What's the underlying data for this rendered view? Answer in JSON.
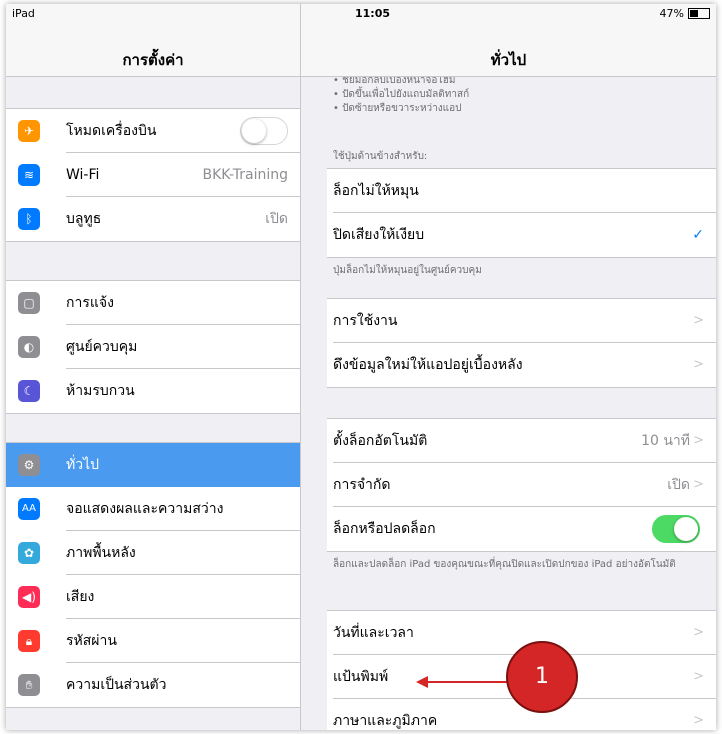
{
  "status": {
    "device": "iPad",
    "time": "11:05",
    "battery": "47%",
    "battery_fraction": 0.47
  },
  "left": {
    "title": "การตั้งค่า",
    "group1": [
      {
        "label": "โหมดเครื่องบิน",
        "icon": "airplane-icon",
        "color": "#ff9500",
        "toggle": false
      },
      {
        "label": "Wi-Fi",
        "value": "BKK-Training",
        "icon": "wifi-icon",
        "color": "#007aff"
      },
      {
        "label": "บลูทูธ",
        "value": "เปิด",
        "icon": "bluetooth-icon",
        "color": "#007aff"
      }
    ],
    "group2": [
      {
        "label": "การแจ้ง",
        "icon": "notifications-icon",
        "color": "#8e8e93"
      },
      {
        "label": "ศูนย์ควบคุม",
        "icon": "control-center-icon",
        "color": "#8e8e93"
      },
      {
        "label": "ห้ามรบกวน",
        "icon": "moon-icon",
        "color": "#5856d6"
      }
    ],
    "group3": [
      {
        "label": "ทั่วไป",
        "icon": "gear-icon",
        "color": "#8e8e93",
        "selected": true
      },
      {
        "label": "จอแสดงผลและความสว่าง",
        "icon": "display-icon",
        "color": "#007aff"
      },
      {
        "label": "ภาพพื้นหลัง",
        "icon": "wallpaper-icon",
        "color": "#34aadc"
      },
      {
        "label": "เสียง",
        "icon": "sound-icon",
        "color": "#ff2d55"
      },
      {
        "label": "รหัสผ่าน",
        "icon": "lock-icon",
        "color": "#ff3b30"
      },
      {
        "label": "ความเป็นส่วนตัว",
        "icon": "hand-icon",
        "color": "#8e8e93"
      }
    ]
  },
  "right": {
    "title": "ทั่วไป",
    "top_notes": [
      "• ชัยมือกลับเบื้องหน้าจอโฮม",
      "• ปัดขึ้นเพื่อไปยังแถบมัลติทาสก์",
      "• ปัดซ้ายหรือขวาระหว่างแอป"
    ],
    "side_switch_header": "ใช้ปุ่มด้านข้างสำหรับ:",
    "side_switch": [
      {
        "label": "ล็อกไม่ให้หมุน"
      },
      {
        "label": "ปิดเสียงให้เงียบ",
        "checked": true
      }
    ],
    "side_switch_footer": "ปุ่มล็อกไม่ให้หมุนอยู่ในศูนย์ควบคุม",
    "usage": [
      {
        "label": "การใช้งาน"
      },
      {
        "label": "ดึงข้อมูลใหม่ให้แอปอยู่เบื้องหลัง"
      }
    ],
    "lock": [
      {
        "label": "ตั้งล็อกอัตโนมัติ",
        "value": "10 นาที"
      },
      {
        "label": "การจำกัด",
        "value": "เปิด"
      },
      {
        "label": "ล็อกหรือปลดล็อก",
        "toggle": true
      }
    ],
    "lock_footer": "ล็อกและปลดล็อก iPad ของคุณขณะที่คุณปิดและเปิดปกของ iPad อย่างอัตโนมัติ",
    "datetime": [
      {
        "label": "วันที่และเวลา"
      },
      {
        "label": "แป้นพิมพ์"
      },
      {
        "label": "ภาษาและภูมิภาค"
      }
    ]
  },
  "annotation": {
    "number": "1",
    "color": "#d42626"
  }
}
